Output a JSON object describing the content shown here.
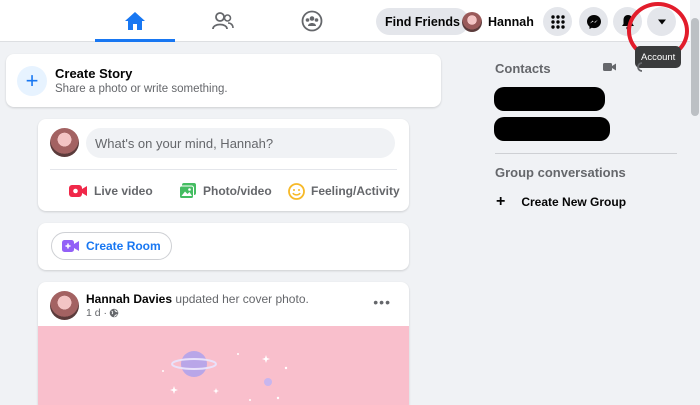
{
  "topbar": {
    "tabs": [
      {
        "icon": "home-icon",
        "active": true
      },
      {
        "icon": "friends-icon",
        "active": false
      },
      {
        "icon": "groups-icon",
        "active": false
      }
    ],
    "find_friends": "Find Friends",
    "profile_name": "Hannah",
    "icons": [
      "menu-grid-icon",
      "messenger-icon",
      "notifications-icon",
      "account-caret-icon"
    ],
    "tooltip": "Account"
  },
  "story": {
    "title": "Create Story",
    "subtitle": "Share a photo or write something."
  },
  "composer": {
    "placeholder": "What's on your mind, Hannah?",
    "actions": {
      "live": "Live video",
      "photo": "Photo/video",
      "feeling": "Feeling/Activity"
    }
  },
  "room": {
    "label": "Create Room"
  },
  "post": {
    "author": "Hannah Davies",
    "action": "updated her cover photo.",
    "time": "1 d ·"
  },
  "sidebar": {
    "contacts_title": "Contacts",
    "group_title": "Group conversations",
    "new_group": "Create New Group"
  },
  "colors": {
    "brand": "#1877f2",
    "highlight_ring": "#e21c2b",
    "cover": "#f9bfcc"
  }
}
